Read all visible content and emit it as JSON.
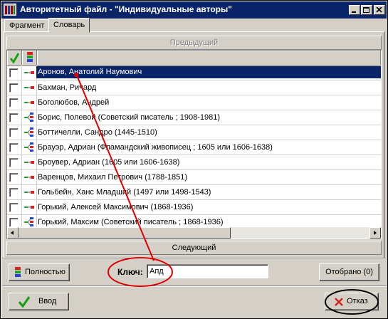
{
  "window": {
    "title": "Авторитетный файл - \"Индивидуальные авторы\""
  },
  "tabs": [
    {
      "label": "Фрагмент",
      "active": false
    },
    {
      "label": "Словарь",
      "active": true
    }
  ],
  "nav": {
    "prev_label": "Предыдущий",
    "next_label": "Следующий"
  },
  "list": {
    "columns": [
      "check-column",
      "type-column",
      "name-column"
    ],
    "selected_index": 0,
    "rows": [
      {
        "text": "Аронов, Анатолий Наумович",
        "icon": "single-link-icon"
      },
      {
        "text": "Бахман, Ричард",
        "icon": "single-link-icon"
      },
      {
        "text": "Боголюбов, Андрей",
        "icon": "single-link-icon"
      },
      {
        "text": "Борис, Полевой (Советский писатель ; 1908-1981)",
        "icon": "multi-link-icon"
      },
      {
        "text": "Боттичелли, Сандро (1445-1510)",
        "icon": "multi-link-icon"
      },
      {
        "text": "Брауэр, Адриан (Фламандский живописец ; 1605 или 1606-1638)",
        "icon": "multi-link-icon"
      },
      {
        "text": "Броувер, Адриан (1605 или 1606-1638)",
        "icon": "single-link-icon"
      },
      {
        "text": "Варенцов, Михаил Петрович (1788-1851)",
        "icon": "single-link-icon"
      },
      {
        "text": "Гольбейн, Ханс Младший (1497 или 1498-1543)",
        "icon": "single-link-icon"
      },
      {
        "text": "Горький, Алексей Максимович (1868-1936)",
        "icon": "single-link-icon"
      },
      {
        "text": "Горький, Максим (Советский писатель ; 1868-1936)",
        "icon": "multi-link-icon"
      }
    ]
  },
  "controls": {
    "full_label": "Полностью",
    "key_label": "Ключ:",
    "key_value": "Апд",
    "selected_label": "Отобрано (0)",
    "enter_label": "Ввод",
    "cancel_label": "Отказ"
  },
  "colors": {
    "selection": "#0a246a",
    "annotation": "#e00000",
    "face": "#d4d0c8"
  }
}
